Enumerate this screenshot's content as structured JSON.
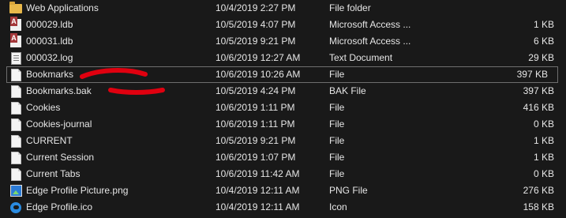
{
  "files": [
    {
      "name": "Web Applications",
      "date": "10/4/2019 2:27 PM",
      "type": "File folder",
      "size": "",
      "icon": "folder-icon"
    },
    {
      "name": "000029.ldb",
      "date": "10/5/2019 4:07 PM",
      "type": "Microsoft Access ...",
      "size": "1 KB",
      "icon": "access-file-icon"
    },
    {
      "name": "000031.ldb",
      "date": "10/5/2019 9:21 PM",
      "type": "Microsoft Access ...",
      "size": "6 KB",
      "icon": "access-file-icon"
    },
    {
      "name": "000032.log",
      "date": "10/6/2019 12:27 AM",
      "type": "Text Document",
      "size": "29 KB",
      "icon": "text-document-icon"
    },
    {
      "name": "Bookmarks",
      "date": "10/6/2019 10:26 AM",
      "type": "File",
      "size": "397 KB",
      "icon": "file-icon",
      "selected": true
    },
    {
      "name": "Bookmarks.bak",
      "date": "10/5/2019 4:24 PM",
      "type": "BAK File",
      "size": "397 KB",
      "icon": "file-icon"
    },
    {
      "name": "Cookies",
      "date": "10/6/2019 1:11 PM",
      "type": "File",
      "size": "416 KB",
      "icon": "file-icon"
    },
    {
      "name": "Cookies-journal",
      "date": "10/6/2019 1:11 PM",
      "type": "File",
      "size": "0 KB",
      "icon": "file-icon"
    },
    {
      "name": "CURRENT",
      "date": "10/5/2019 9:21 PM",
      "type": "File",
      "size": "1 KB",
      "icon": "file-icon"
    },
    {
      "name": "Current Session",
      "date": "10/6/2019 1:07 PM",
      "type": "File",
      "size": "1 KB",
      "icon": "file-icon"
    },
    {
      "name": "Current Tabs",
      "date": "10/6/2019 11:42 AM",
      "type": "File",
      "size": "0 KB",
      "icon": "file-icon"
    },
    {
      "name": "Edge Profile Picture.png",
      "date": "10/4/2019 12:11 AM",
      "type": "PNG File",
      "size": "276 KB",
      "icon": "png-image-icon"
    },
    {
      "name": "Edge Profile.ico",
      "date": "10/4/2019 12:11 AM",
      "type": "Icon",
      "size": "158 KB",
      "icon": "edge-icon"
    }
  ],
  "annotation_color": "#e0000f"
}
